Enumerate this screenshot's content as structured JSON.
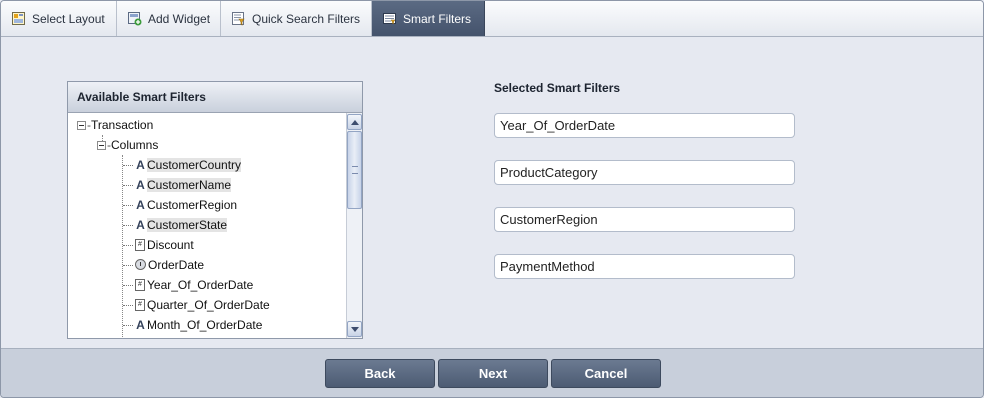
{
  "tabs": [
    {
      "label": "Select Layout",
      "icon": "layout-icon",
      "active": false
    },
    {
      "label": "Add Widget",
      "icon": "add-widget-icon",
      "active": false
    },
    {
      "label": "Quick Search Filters",
      "icon": "quick-filter-icon",
      "active": false
    },
    {
      "label": "Smart Filters",
      "icon": "smart-filter-icon",
      "active": true
    }
  ],
  "available": {
    "title": "Available Smart Filters",
    "root": "Transaction",
    "group": "Columns",
    "items": [
      {
        "label": "CustomerCountry",
        "type": "text",
        "highlighted": true
      },
      {
        "label": "CustomerName",
        "type": "text",
        "highlighted": true
      },
      {
        "label": "CustomerRegion",
        "type": "text",
        "highlighted": false
      },
      {
        "label": "CustomerState",
        "type": "text",
        "highlighted": true
      },
      {
        "label": "Discount",
        "type": "numeric",
        "highlighted": false
      },
      {
        "label": "OrderDate",
        "type": "date",
        "highlighted": false
      },
      {
        "label": "Year_Of_OrderDate",
        "type": "numeric",
        "highlighted": false
      },
      {
        "label": "Quarter_Of_OrderDate",
        "type": "numeric",
        "highlighted": false
      },
      {
        "label": "Month_Of_OrderDate",
        "type": "text",
        "highlighted": false
      }
    ]
  },
  "selected": {
    "title": "Selected Smart Filters",
    "fields": [
      "Year_Of_OrderDate",
      "ProductCategory",
      "CustomerRegion",
      "PaymentMethod"
    ]
  },
  "footer": {
    "back_label": "Back",
    "next_label": "Next",
    "cancel_label": "Cancel"
  },
  "colors": {
    "active_tab": "#4f5e78",
    "button": "#5a6981",
    "highlight": "#e4e4e4"
  }
}
